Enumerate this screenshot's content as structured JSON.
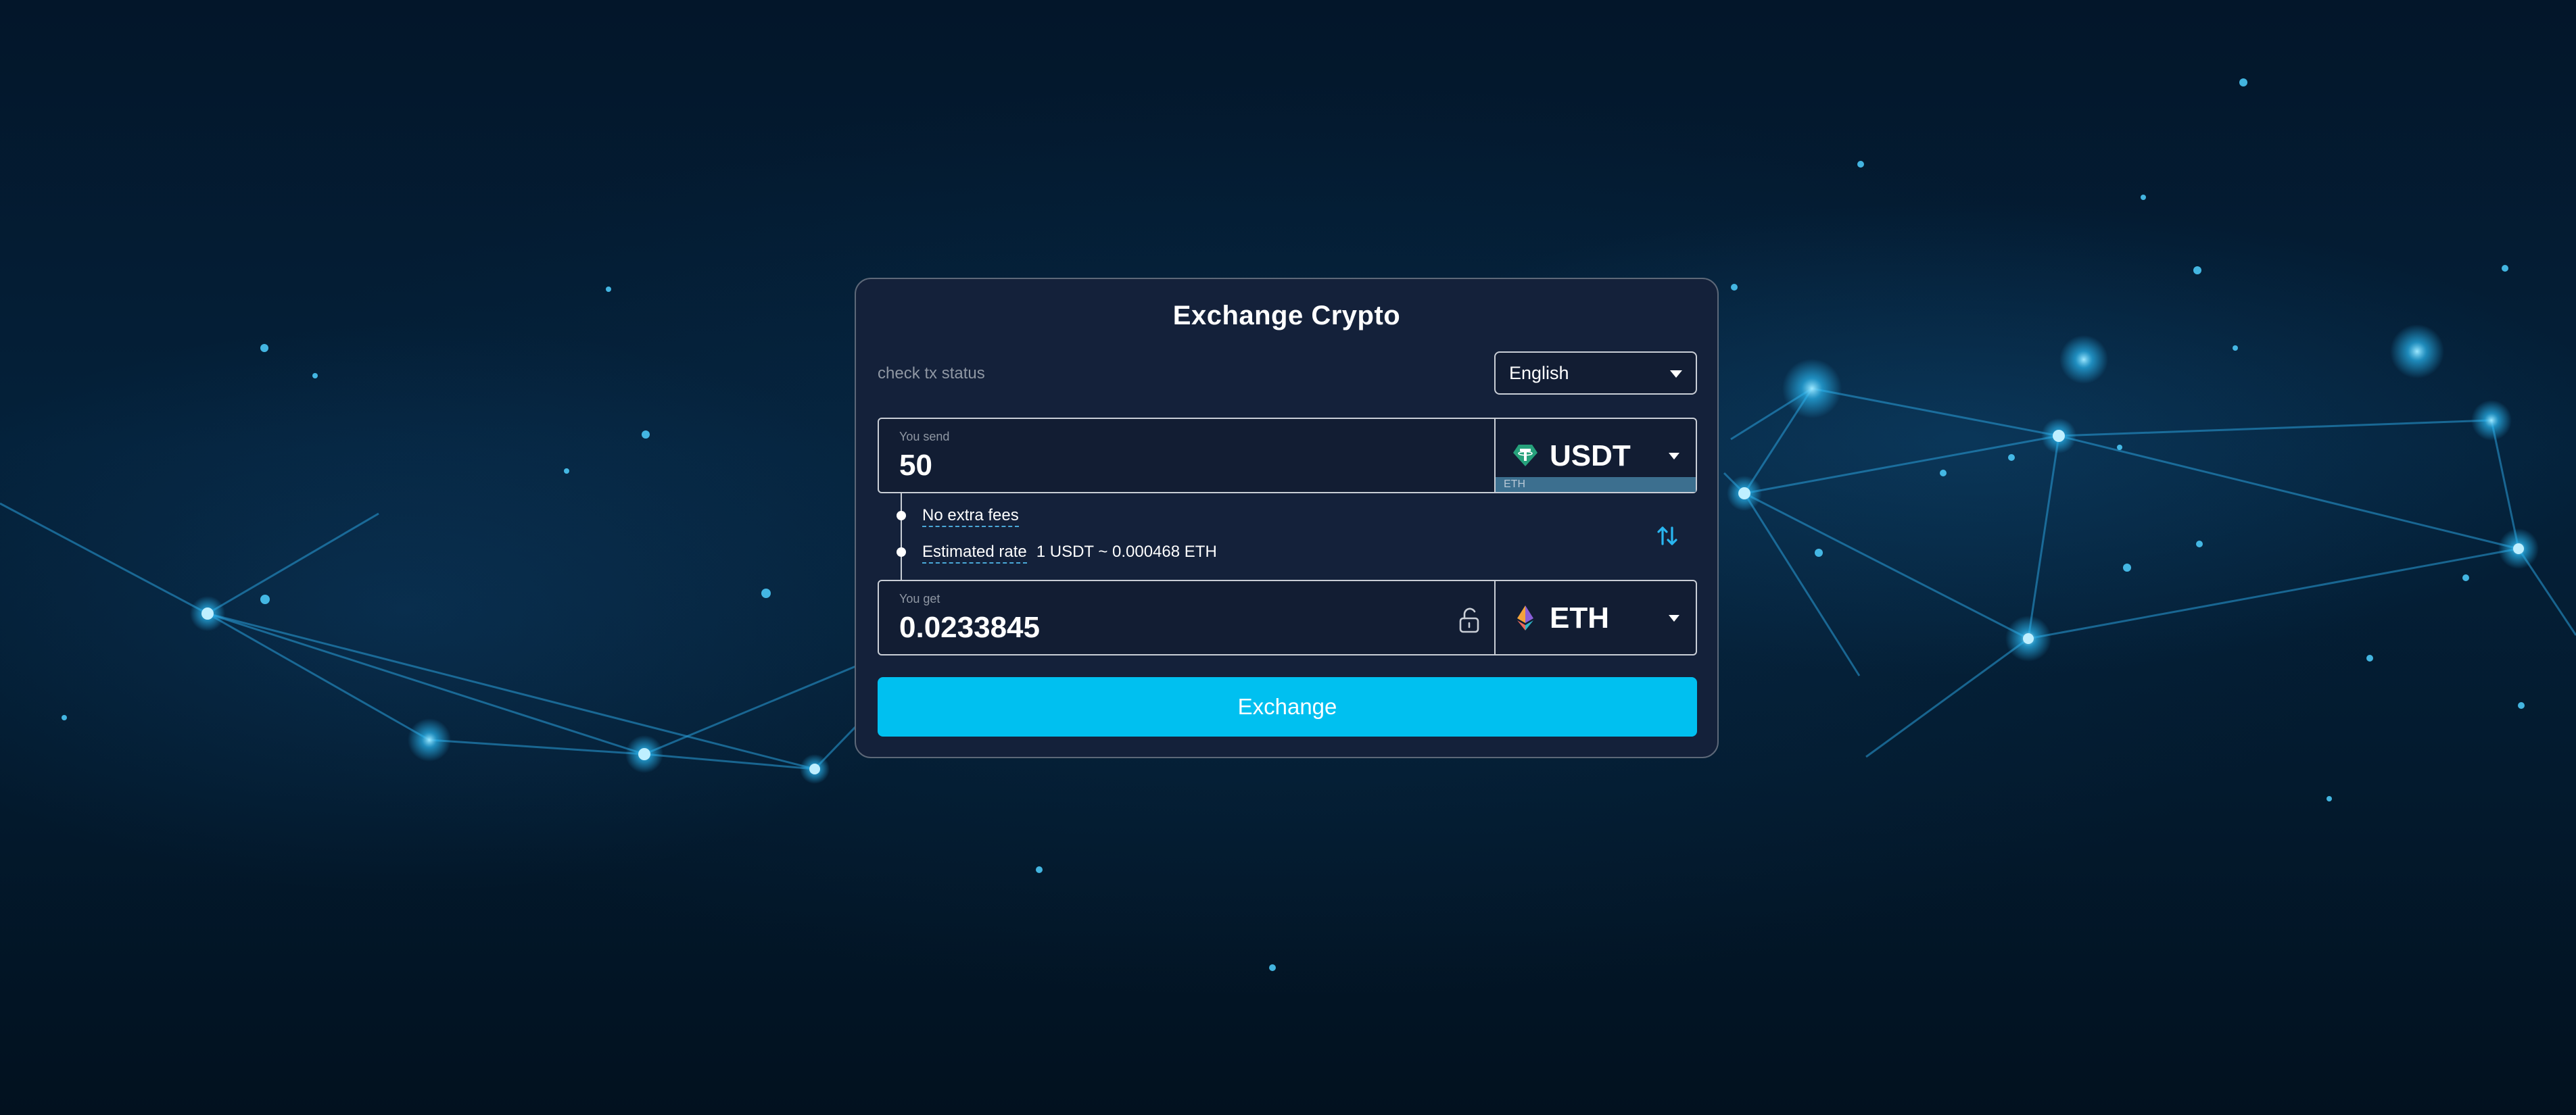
{
  "title": "Exchange Crypto",
  "check_status_link": "check tx status",
  "language": {
    "selected": "English"
  },
  "send": {
    "label": "You send",
    "amount": "50",
    "coin": "USDT",
    "coin_icon": "tether-icon",
    "network": "ETH"
  },
  "info": {
    "fees_label": "No extra fees",
    "rate_label": "Estimated rate",
    "rate_value": "1 USDT ~ 0.000468 ETH"
  },
  "get": {
    "label": "You get",
    "amount": "0.0233845",
    "coin": "ETH",
    "coin_icon": "ethereum-icon"
  },
  "exchange_button": "Exchange",
  "colors": {
    "accent": "#00c0f0",
    "card_bg": "#14213a",
    "background": "#03162a"
  }
}
